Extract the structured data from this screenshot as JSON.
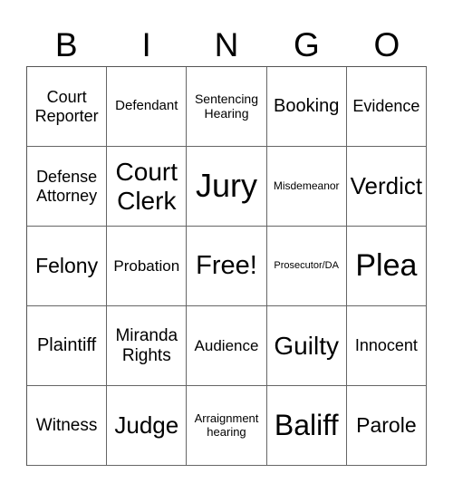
{
  "header": [
    "B",
    "I",
    "N",
    "G",
    "O"
  ],
  "cells": [
    {
      "text": "Court Reporter",
      "size": 18
    },
    {
      "text": "Defendant",
      "size": 15
    },
    {
      "text": "Sentencing Hearing",
      "size": 14
    },
    {
      "text": "Booking",
      "size": 20
    },
    {
      "text": "Evidence",
      "size": 18
    },
    {
      "text": "Defense Attorney",
      "size": 18
    },
    {
      "text": "Court Clerk",
      "size": 28
    },
    {
      "text": "Jury",
      "size": 36
    },
    {
      "text": "Misdemeanor",
      "size": 12
    },
    {
      "text": "Verdict",
      "size": 26
    },
    {
      "text": "Felony",
      "size": 23
    },
    {
      "text": "Probation",
      "size": 17
    },
    {
      "text": "Free!",
      "size": 29
    },
    {
      "text": "Prosecutor/DA",
      "size": 11
    },
    {
      "text": "Plea",
      "size": 34
    },
    {
      "text": "Plaintiff",
      "size": 20
    },
    {
      "text": "Miranda Rights",
      "size": 19
    },
    {
      "text": "Audience",
      "size": 17
    },
    {
      "text": "Guilty",
      "size": 28
    },
    {
      "text": "Innocent",
      "size": 18
    },
    {
      "text": "Witness",
      "size": 19
    },
    {
      "text": "Judge",
      "size": 26
    },
    {
      "text": "Arraignment hearing",
      "size": 13
    },
    {
      "text": "Baliff",
      "size": 32
    },
    {
      "text": "Parole",
      "size": 23
    }
  ]
}
